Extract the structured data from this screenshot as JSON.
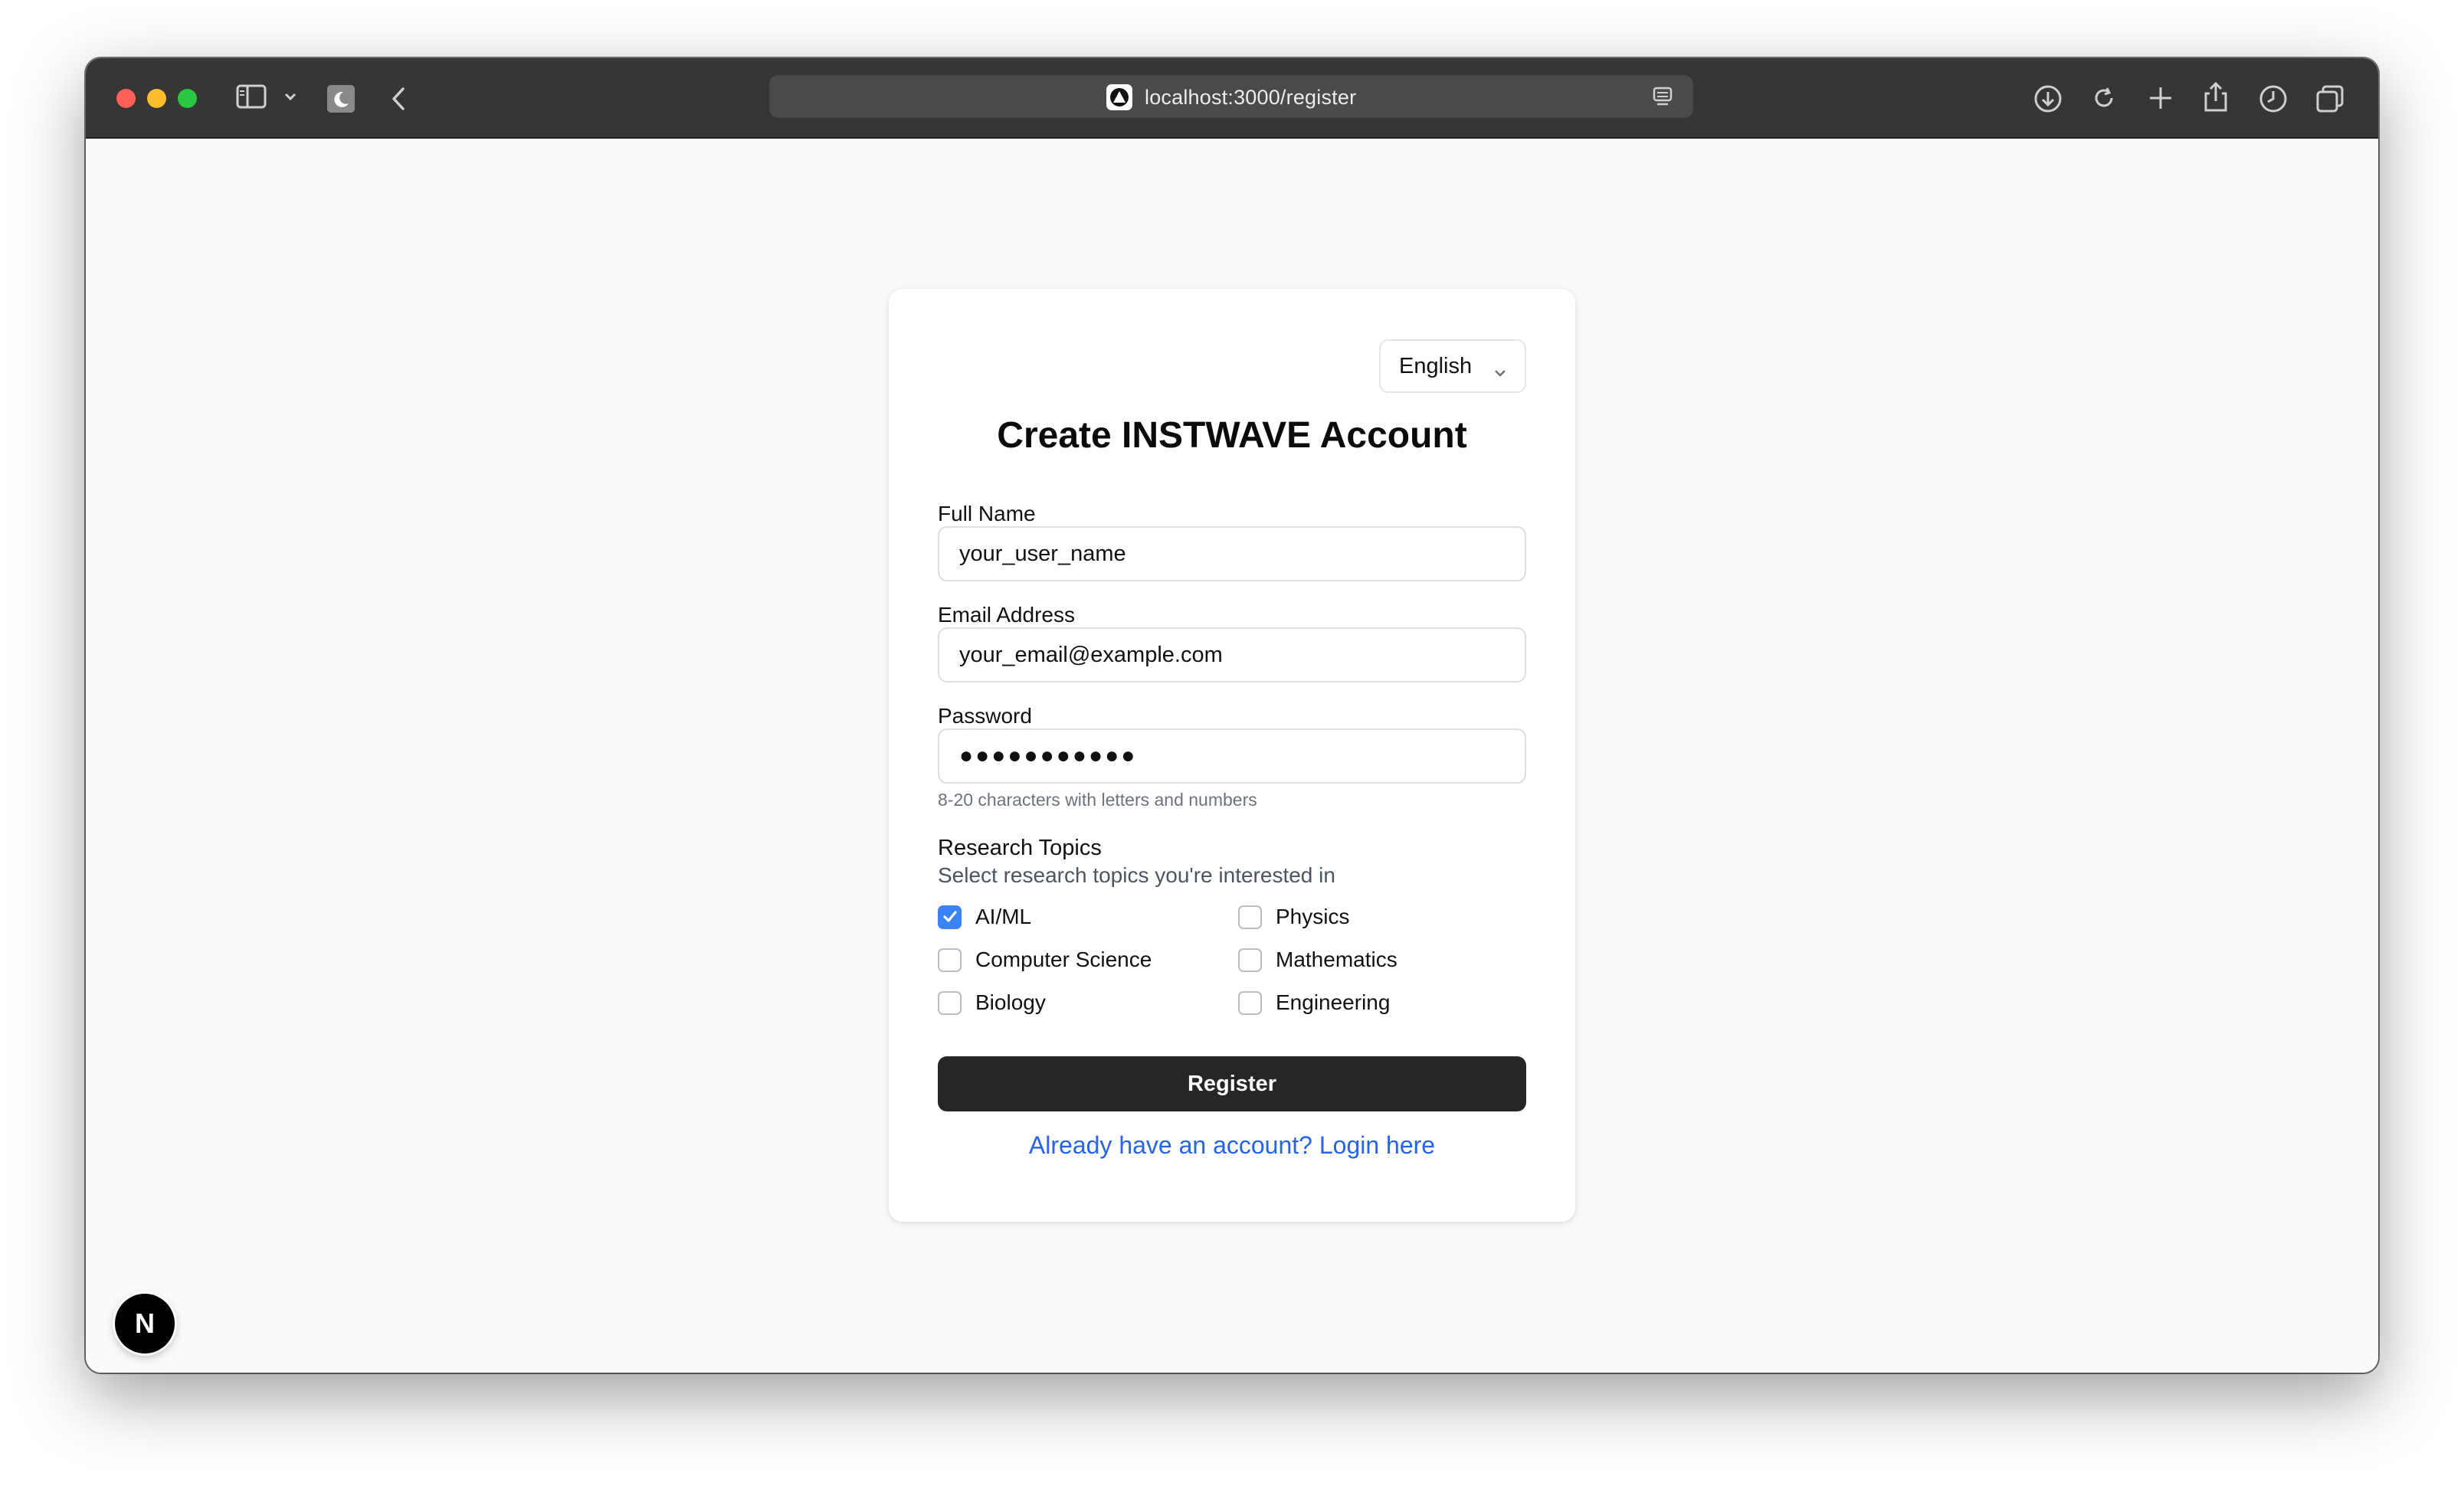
{
  "browser": {
    "url": "localhost:3000/register"
  },
  "form": {
    "language": "English",
    "title": "Create INSTWAVE Account",
    "full_name_label": "Full Name",
    "full_name_value": "your_user_name",
    "email_label": "Email Address",
    "email_value": "your_email@example.com",
    "password_label": "Password",
    "password_value": "●●●●●●●●●●●",
    "password_hint": "8-20 characters with letters and numbers",
    "topics_label": "Research Topics",
    "topics_desc": "Select research topics you're interested in",
    "topics": [
      {
        "label": "AI/ML",
        "checked": true
      },
      {
        "label": "Physics",
        "checked": false
      },
      {
        "label": "Computer Science",
        "checked": false
      },
      {
        "label": "Mathematics",
        "checked": false
      },
      {
        "label": "Biology",
        "checked": false
      },
      {
        "label": "Engineering",
        "checked": false
      }
    ],
    "register_label": "Register",
    "login_link": "Already have an account? Login here"
  },
  "dev_badge": "N",
  "colors": {
    "accent": "#3b82f6",
    "link": "#2563eb",
    "button": "#262626"
  }
}
